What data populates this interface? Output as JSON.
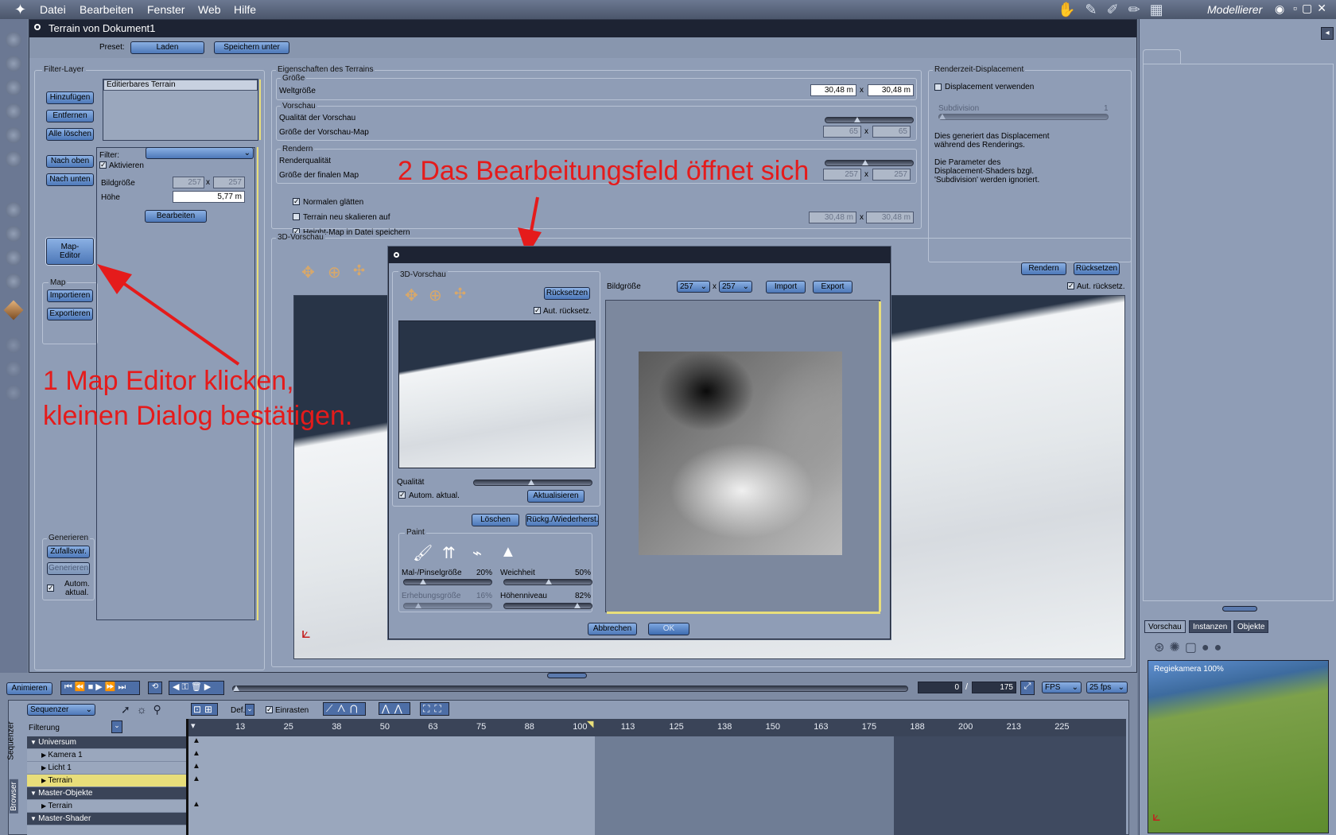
{
  "menu": {
    "items": [
      "Datei",
      "Bearbeiten",
      "Fenster",
      "Web",
      "Hilfe"
    ],
    "mode": "Modellierer"
  },
  "window": {
    "title": "Terrain von Dokument1",
    "preset_label": "Preset:",
    "load": "Laden",
    "save_as": "Speichern unter"
  },
  "filter_layer": {
    "title": "Filter-Layer",
    "buttons": [
      "Hinzufügen",
      "Entfernen",
      "Alle löschen",
      "Nach oben",
      "Nach unten"
    ],
    "map_editor": "Map-Editor",
    "map_editor_l1": "Map-",
    "map_editor_l2": "Editor",
    "map_group": "Map",
    "import": "Importieren",
    "export": "Exportieren",
    "list_item": "Editierbares Terrain",
    "filter_label": "Filter:",
    "activate": "Aktivieren",
    "image_size_label": "Bildgröße",
    "image_w": "257",
    "image_h": "257",
    "height_label": "Höhe",
    "height_value": "5,77 m",
    "edit": "Bearbeiten",
    "generate_group": "Generieren",
    "random": "Zufallsvar.",
    "generate": "Generieren",
    "auto_update_l1": "Autom.",
    "auto_update_l2": "aktual."
  },
  "properties": {
    "title": "Eigenschaften des Terrains",
    "size_group": "Größe",
    "world_size": "Weltgröße",
    "world_w": "30,48 m",
    "world_h": "30,48 m",
    "preview_group": "Vorschau",
    "preview_quality": "Qualität der Vorschau",
    "preview_map_size": "Größe der Vorschau-Map",
    "preview_w": "65",
    "preview_h": "65",
    "render_group": "Rendern",
    "render_quality": "Renderqualität",
    "final_map_size": "Größe der finalen Map",
    "final_w": "257",
    "final_h": "257",
    "smooth_normals": "Normalen glätten",
    "rescale": "Terrain neu skalieren auf",
    "rescale_w": "30,48 m",
    "rescale_h": "30,48 m",
    "save_heightmap": "Height-Map in Datei speichern",
    "x": "x"
  },
  "displacement": {
    "title": "Renderzeit-Displacement",
    "use": "Displacement verwenden",
    "subdivision": "Subdivision",
    "subdivision_value": "1",
    "note1": "Dies generiert das Displacement während des Renderings.",
    "note2": "Die Parameter des Displacement-Shaders bzgl. 'Subdivision' werden ignoriert."
  },
  "preview3d": {
    "title": "3D-Vorschau",
    "render": "Rendern",
    "reset": "Rücksetzen",
    "auto_reset": "Aut. rücksetz."
  },
  "dialog": {
    "preview_title": "3D-Vorschau",
    "reset": "Rücksetzen",
    "auto_reset": "Aut. rücksetz.",
    "quality": "Qualität",
    "auto_update": "Autom. aktual.",
    "update": "Aktualisieren",
    "delete": "Löschen",
    "undo": "Rückg./Wiederherst.",
    "paint": "Paint",
    "brush_size": "Mal-/Pinselgröße",
    "brush_size_value": "20%",
    "softness": "Weichheit",
    "softness_value": "50%",
    "elevation": "Erhebungsgröße",
    "elevation_value": "16%",
    "height_level": "Höhenniveau",
    "height_level_value": "82%",
    "image_size": "Bildgröße",
    "size_w": "257",
    "size_h": "257",
    "import": "Import",
    "export": "Export",
    "cancel": "Abbrechen",
    "ok": "OK"
  },
  "annotations": {
    "a1_line1": "1 Map Editor klicken,",
    "a1_line2": "kleinen Dialog bestätigen.",
    "a2": "2 Das Bearbeitungsfeld öffnet sich"
  },
  "timeline": {
    "animate": "Animieren",
    "frame_current": "0",
    "frame_sep": "/",
    "frame_total": "175",
    "fps_label": "FPS",
    "fps_value": "25 fps",
    "sequencer": "Sequenzer",
    "def": "Def.",
    "snap": "Einrasten",
    "filter": "Filterung",
    "side_tabs": [
      "Sequenzer",
      "Browser"
    ],
    "ticks": [
      "13",
      "25",
      "38",
      "50",
      "63",
      "75",
      "88",
      "100",
      "113",
      "125",
      "138",
      "150",
      "163",
      "175",
      "188",
      "200",
      "213",
      "225"
    ],
    "tracks": [
      {
        "label": "Universum",
        "group": true
      },
      {
        "label": "Kamera 1",
        "group": false
      },
      {
        "label": "Licht 1",
        "group": false
      },
      {
        "label": "Terrain",
        "group": false,
        "selected": true
      },
      {
        "label": "Master-Objekte",
        "group": true
      },
      {
        "label": "Terrain",
        "group": false
      },
      {
        "label": "Master-Shader",
        "group": true
      }
    ]
  },
  "right_panel": {
    "tabs": [
      "Vorschau",
      "Instanzen",
      "Objekte"
    ],
    "camera_label": "Regiekamera 100%"
  },
  "colors": {
    "accent_red": "#e51b1b",
    "button_blue": "#5a86c6",
    "selection_yellow": "#e8de7a"
  }
}
